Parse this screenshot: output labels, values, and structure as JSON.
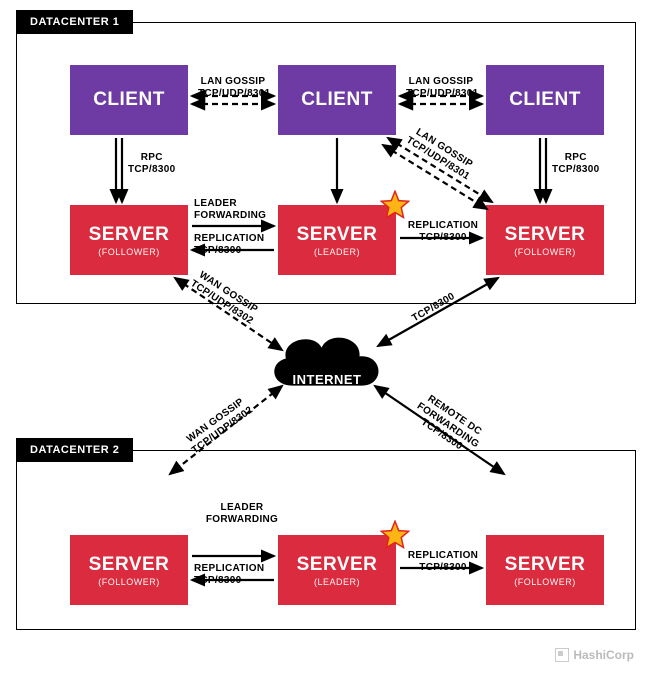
{
  "dc1": {
    "label": "DATACENTER 1"
  },
  "dc2": {
    "label": "DATACENTER 2"
  },
  "nodes": {
    "client": "CLIENT",
    "server": "SERVER",
    "follower": "(FOLLOWER)",
    "leader": "(LEADER)"
  },
  "internet": "INTERNET",
  "conn": {
    "lan_gossip": "LAN GOSSIP",
    "lan_port": "TCP/UDP/8301",
    "rpc": "RPC",
    "rpc_port": "TCP/8300",
    "leader_fwd": "LEADER FORWARDING",
    "replication": "REPLICATION",
    "repl_port": "TCP/8300",
    "wan_gossip": "WAN GOSSIP",
    "wan_port": "TCP/UDP/8302",
    "remote_fwd": "REMOTE DC FORWARDING",
    "fwd_port": "TCP/8300"
  },
  "watermark": "HashiCorp"
}
